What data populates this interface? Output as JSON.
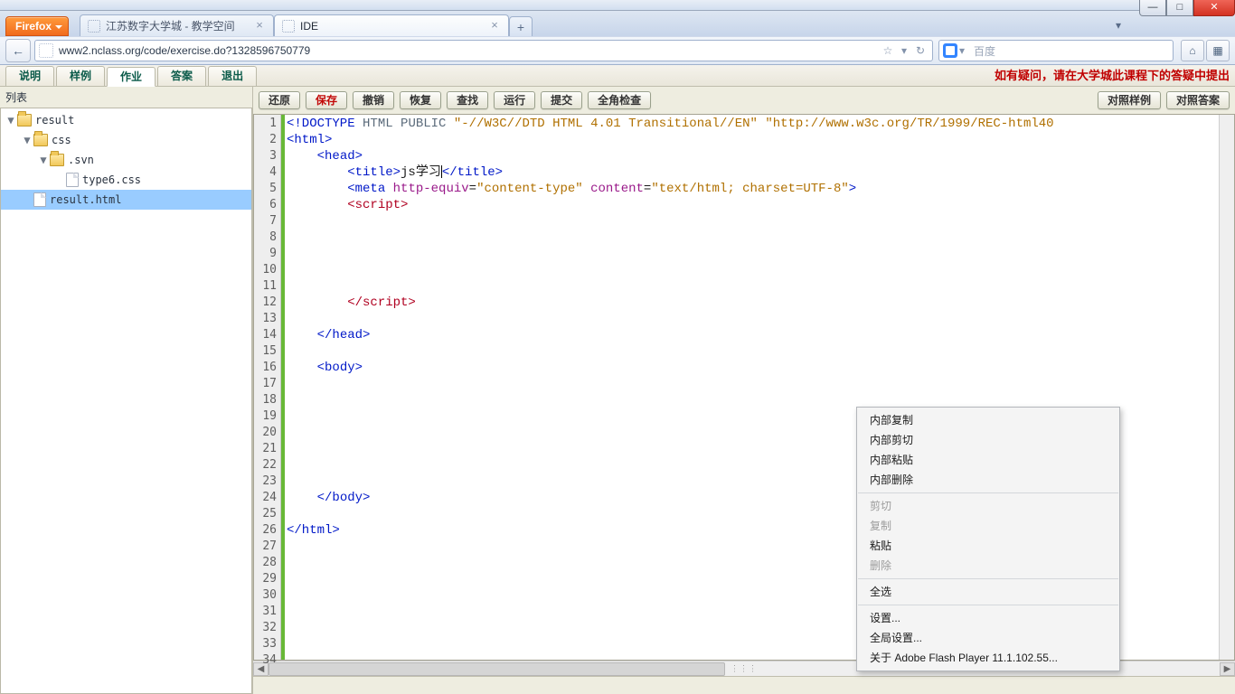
{
  "os": {
    "min": "—",
    "max": "□",
    "close": "✕"
  },
  "firefox": {
    "menu_label": "Firefox",
    "tabs": [
      {
        "title": "江苏数字大学城 - 教学空间",
        "active": false
      },
      {
        "title": "IDE",
        "active": true
      }
    ],
    "newtab_glyph": "+",
    "menu_arrow": "▾",
    "nav": {
      "back": "←",
      "url": "www2.nclass.org/code/exercise.do?1328596750779",
      "star": "☆",
      "dropdown": "▾",
      "reload": "↻",
      "search_placeholder": "百度",
      "home": "⌂",
      "bookmarks": "▦"
    }
  },
  "page_tabs": {
    "items": [
      "说明",
      "样例",
      "作业",
      "答案",
      "退出"
    ],
    "active_index": 2,
    "notice": "如有疑问，请在大学城此课程下的答疑中提出"
  },
  "sidebar": {
    "title": "列表",
    "tree": [
      {
        "level": 1,
        "type": "folder",
        "open": true,
        "label": "result"
      },
      {
        "level": 2,
        "type": "folder",
        "open": true,
        "label": "css"
      },
      {
        "level": 3,
        "type": "folder",
        "open": true,
        "label": ".svn"
      },
      {
        "level": 4,
        "type": "file",
        "label": "type6.css"
      },
      {
        "level": 2,
        "type": "file",
        "label": "result.html",
        "selected": true
      }
    ]
  },
  "toolbar": {
    "left": [
      "还原",
      "保存",
      "撤销",
      "恢复",
      "查找",
      "运行",
      "提交",
      "全角检查"
    ],
    "red_index": 1,
    "right": [
      "对照样例",
      "对照答案"
    ]
  },
  "editor": {
    "lines": [
      {
        "n": 1,
        "html": "<span class=\"t-tag\">&lt;!DOCTYPE</span> <span class=\"t-doc\">HTML PUBLIC </span><span class=\"t-str\">\"-//W3C//DTD HTML 4.01 Transitional//EN\"</span> <span class=\"t-str\">\"http://www.w3c.org/TR/1999/REC-html40</span>"
      },
      {
        "n": 2,
        "html": "<span class=\"t-tag\">&lt;html&gt;</span>"
      },
      {
        "n": 3,
        "html": "    <span class=\"t-tag\">&lt;head&gt;</span>"
      },
      {
        "n": 4,
        "html": "        <span class=\"t-tag\">&lt;title&gt;</span>js学习<span class=\"cursor\"></span><span class=\"t-tag\">&lt;/title&gt;</span>"
      },
      {
        "n": 5,
        "html": "        <span class=\"t-tag\">&lt;meta</span> <span class=\"t-attr\">http-equiv</span>=<span class=\"t-str\">\"content-type\"</span> <span class=\"t-attr\">content</span>=<span class=\"t-str\">\"text/html; charset=UTF-8\"</span><span class=\"t-tag\">&gt;</span>"
      },
      {
        "n": 6,
        "html": "        <span class=\"t-script\">&lt;script&gt;</span>"
      },
      {
        "n": 7,
        "html": ""
      },
      {
        "n": 8,
        "html": ""
      },
      {
        "n": 9,
        "html": ""
      },
      {
        "n": 10,
        "html": ""
      },
      {
        "n": 11,
        "html": ""
      },
      {
        "n": 12,
        "html": "        <span class=\"t-script\">&lt;/script&gt;</span>"
      },
      {
        "n": 13,
        "html": ""
      },
      {
        "n": 14,
        "html": "    <span class=\"t-tag\">&lt;/head&gt;</span>"
      },
      {
        "n": 15,
        "html": ""
      },
      {
        "n": 16,
        "html": "    <span class=\"t-tag\">&lt;body&gt;</span>"
      },
      {
        "n": 17,
        "html": ""
      },
      {
        "n": 18,
        "html": ""
      },
      {
        "n": 19,
        "html": ""
      },
      {
        "n": 20,
        "html": ""
      },
      {
        "n": 21,
        "html": ""
      },
      {
        "n": 22,
        "html": ""
      },
      {
        "n": 23,
        "html": ""
      },
      {
        "n": 24,
        "html": "    <span class=\"t-tag\">&lt;/body&gt;</span>"
      },
      {
        "n": 25,
        "html": ""
      },
      {
        "n": 26,
        "html": "<span class=\"t-tag\">&lt;/html&gt;</span>"
      },
      {
        "n": 27,
        "html": ""
      },
      {
        "n": 28,
        "html": ""
      },
      {
        "n": 29,
        "html": ""
      },
      {
        "n": 30,
        "html": ""
      },
      {
        "n": 31,
        "html": ""
      },
      {
        "n": 32,
        "html": ""
      },
      {
        "n": 33,
        "html": ""
      },
      {
        "n": 34,
        "html": ""
      }
    ]
  },
  "context_menu": {
    "groups": [
      [
        {
          "label": "内部复制"
        },
        {
          "label": "内部剪切"
        },
        {
          "label": "内部粘贴"
        },
        {
          "label": "内部删除"
        }
      ],
      [
        {
          "label": "剪切",
          "disabled": true
        },
        {
          "label": "复制",
          "disabled": true
        },
        {
          "label": "粘贴"
        },
        {
          "label": "删除",
          "disabled": true
        }
      ],
      [
        {
          "label": "全选"
        }
      ],
      [
        {
          "label": "设置..."
        },
        {
          "label": "全局设置..."
        },
        {
          "label": "关于 Adobe Flash Player 11.1.102.55..."
        }
      ]
    ]
  },
  "scroll": {
    "left": "◀",
    "right": "▶",
    "grip": "⋮⋮⋮"
  }
}
